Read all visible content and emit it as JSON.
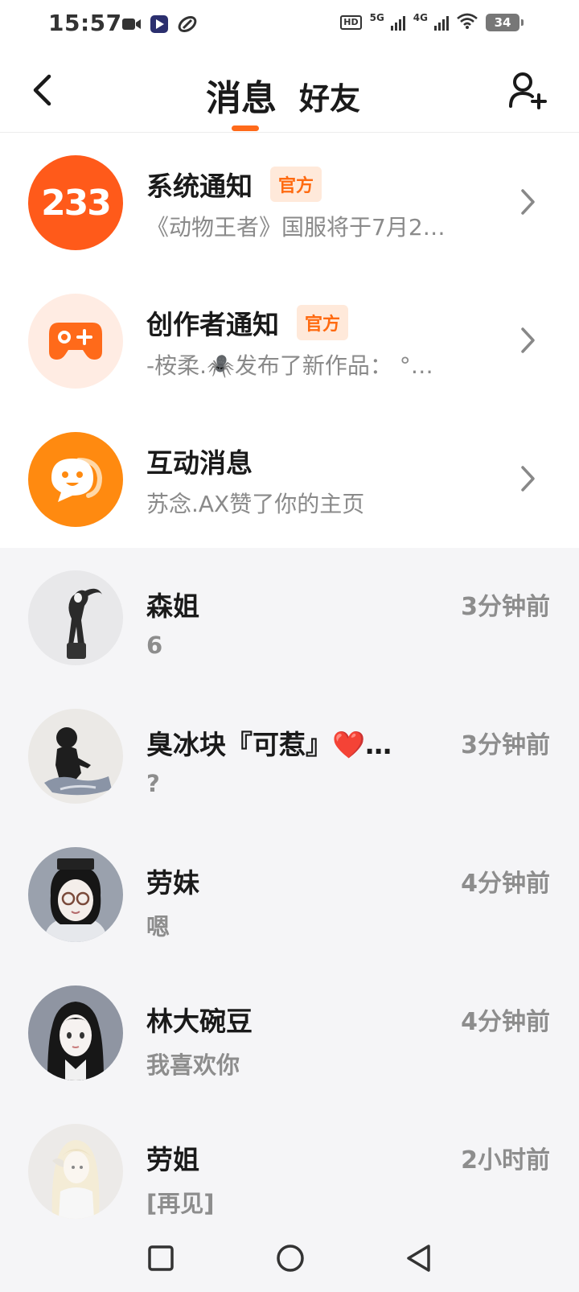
{
  "status_bar": {
    "time": "15:57",
    "hd_label": "HD",
    "net1": "5G",
    "net2": "4G",
    "battery": "34"
  },
  "header": {
    "tab_active": "消息",
    "tab_other": "好友"
  },
  "notifications": [
    {
      "title": "系统通知",
      "badge": "官方",
      "subtitle": "《动物王者》国服将于7月2…",
      "icon": "logo-233-icon",
      "icon_text": "233",
      "color": "#ff5a1a"
    },
    {
      "title": "创作者通知",
      "badge": "官方",
      "subtitle": "-桉柔.🕷️发布了新作品： °…",
      "icon": "gamepad-icon",
      "color": "#ff6a1a"
    },
    {
      "title": "互动消息",
      "badge": "",
      "subtitle": "苏念.AX赞了你的主页",
      "icon": "chat-bubble-icon",
      "color": "#ff8a10"
    }
  ],
  "chats": [
    {
      "name": "森姐",
      "time": "3分钟前",
      "preview": "6"
    },
    {
      "name": "臭冰块『可惹』❤️…",
      "time": "3分钟前",
      "preview": "?"
    },
    {
      "name": "劳妹",
      "time": "4分钟前",
      "preview": "嗯"
    },
    {
      "name": "林大碗豆",
      "time": "4分钟前",
      "preview": "我喜欢你"
    },
    {
      "name": "劳姐",
      "time": "2小时前",
      "preview": "[再见]"
    }
  ],
  "colors": {
    "accent": "#ff6a1a",
    "badge_bg": "#ffe9da",
    "muted_text": "#8d8d8d",
    "list_bg": "#f5f5f7"
  }
}
